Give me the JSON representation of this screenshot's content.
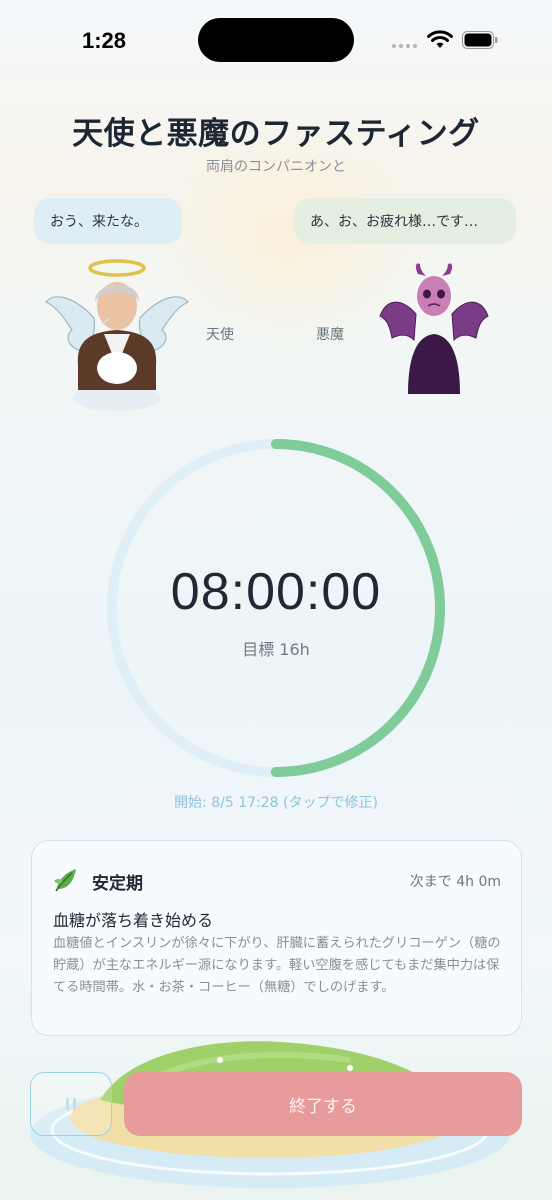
{
  "status_bar": {
    "time": "1:28"
  },
  "header": {
    "title": "天使と悪魔のファスティング",
    "subtitle": "両肩のコンパニオンと"
  },
  "companions": {
    "angel": {
      "bubble": "おう、来たな。",
      "label": "天使",
      "icon": "angel-character-icon"
    },
    "devil": {
      "bubble": "あ、お、お疲れ様…です…",
      "label": "悪魔",
      "icon": "devil-character-icon"
    }
  },
  "timer": {
    "elapsed": "08:00:00",
    "goal_label": "目標 16h",
    "progress": 0.5,
    "start_label": "開始: 8/5 17:28 (タップで修正)",
    "colors": {
      "progress": "#7fcb9a",
      "track": "#e0eef6"
    }
  },
  "phase_card": {
    "icon": "leaf-icon",
    "name": "安定期",
    "remaining": "次まで 4h 0m",
    "heading": "血糖が落ち着き始める",
    "description": "血糖値とインスリンが徐々に下がり、肝臓に蓄えられたグリコーゲン（糖の貯蔵）が主なエネルギー源になります。軽い空腹を感じてもまだ集中力は保てる時間帯。水・お茶・コーヒー（無糖）でしのげます。"
  },
  "actions": {
    "pause_icon": "pause-icon",
    "end_label": "終了する",
    "end_color": "#e89b9b"
  }
}
